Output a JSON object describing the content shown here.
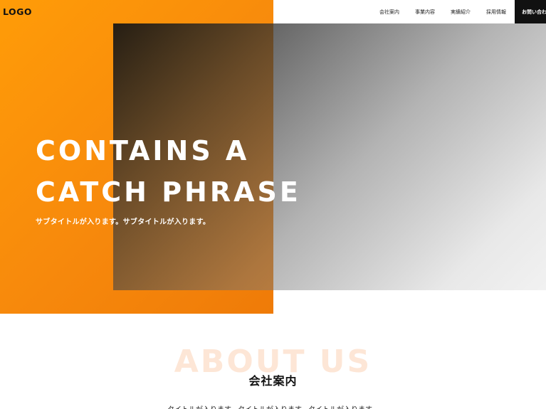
{
  "header": {
    "logo": "LOGO",
    "nav": [
      {
        "label": "会社案内"
      },
      {
        "label": "事業内容"
      },
      {
        "label": "実績紹介"
      },
      {
        "label": "採用情報"
      }
    ],
    "contact_label": "お問い合わ"
  },
  "hero": {
    "catch_line_1": "CONTAINS A",
    "catch_line_2": "CATCH PHRASE",
    "subtitle": "サブタイトルが入ります。サブタイトルが入ります。",
    "colors": {
      "orange": "#ff9c08",
      "overlay_dark": "#1a1a1a",
      "overlay_light": "#cfcfcf"
    }
  },
  "about": {
    "bg_title": "ABOUT US",
    "heading": "会社案内",
    "text": "タイトルが入ります。タイトルが入ります。タイトルが入ります。"
  },
  "colors": {
    "accent": "#ff9c08",
    "dark": "#111111",
    "about_bg_text": "#fde6d6"
  }
}
